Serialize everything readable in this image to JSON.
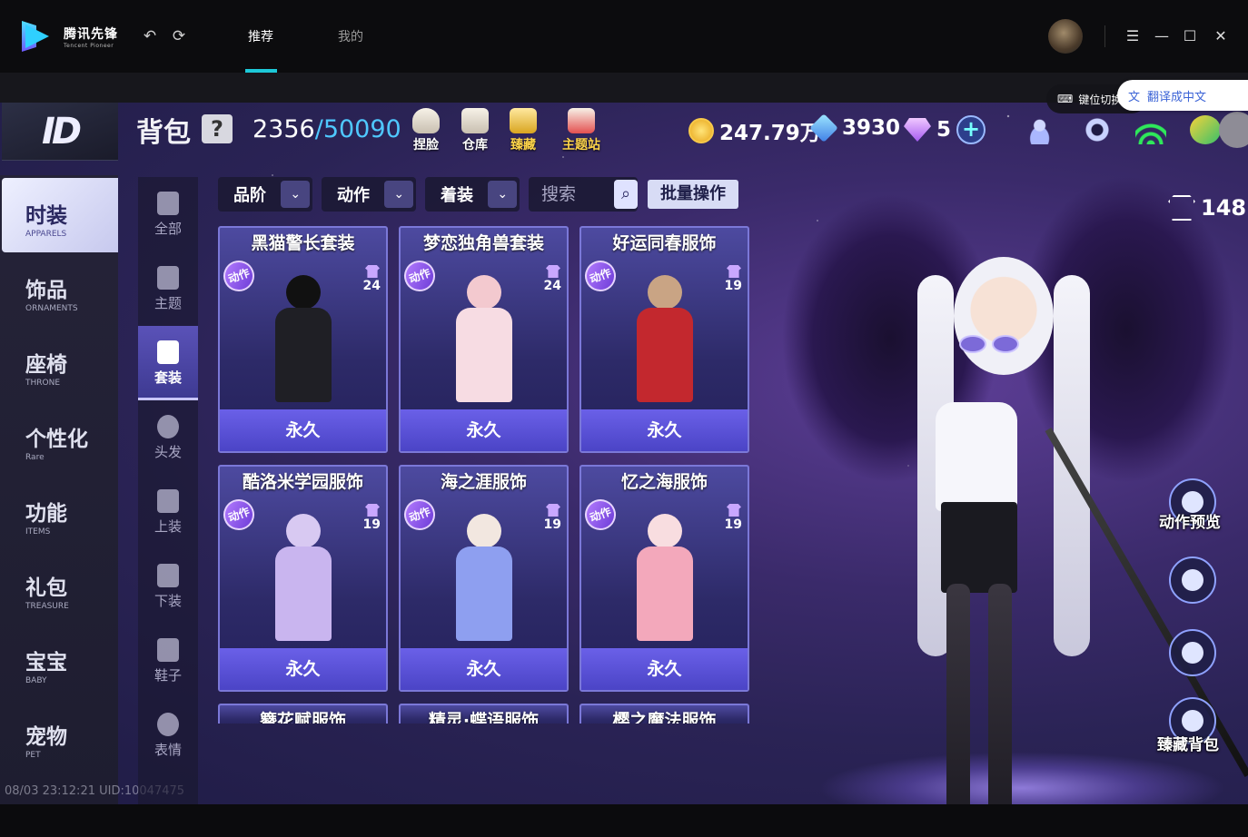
{
  "launcher": {
    "logo_cn": "腾讯先锋",
    "logo_en": "Tencent Pioneer",
    "tabs": [
      "推荐",
      "我的"
    ],
    "active_tab": "推荐",
    "accent_color": "#1dc9d8"
  },
  "overlay": {
    "keymap_label": "键位切换",
    "translate_label": "翻译成中文"
  },
  "hud": {
    "title": "背包",
    "help_label": "?",
    "capacity_used": "2356",
    "capacity_max": "/50090",
    "shortcuts": [
      {
        "label": "捏脸",
        "icon": "bulb-icon"
      },
      {
        "label": "仓库",
        "icon": "warehouse-icon"
      },
      {
        "label": "臻藏",
        "icon": "treasure-icon"
      },
      {
        "label": "主题站",
        "icon": "theme-station-icon"
      }
    ],
    "gold": "247.79万",
    "blue_gem": "3930",
    "diamond": "5",
    "plus_label": "+"
  },
  "categories": [
    {
      "cn": "时装",
      "en": "APPARELS",
      "active": true
    },
    {
      "cn": "饰品",
      "en": "ORNAMENTS"
    },
    {
      "cn": "座椅",
      "en": "THRONE"
    },
    {
      "cn": "个性化",
      "en": "Rare"
    },
    {
      "cn": "功能",
      "en": "ITEMS"
    },
    {
      "cn": "礼包",
      "en": "TREASURE"
    },
    {
      "cn": "宝宝",
      "en": "BABY"
    },
    {
      "cn": "宠物",
      "en": "PET"
    }
  ],
  "subcategories": [
    {
      "label": "全部",
      "icon": "grid-icon"
    },
    {
      "label": "主题",
      "icon": "wand-icon"
    },
    {
      "label": "套装",
      "icon": "outfit-icon",
      "active": true
    },
    {
      "label": "头发",
      "icon": "hair-icon"
    },
    {
      "label": "上装",
      "icon": "top-icon"
    },
    {
      "label": "下装",
      "icon": "pants-icon"
    },
    {
      "label": "鞋子",
      "icon": "shoe-icon"
    },
    {
      "label": "表情",
      "icon": "face-icon"
    }
  ],
  "filters": {
    "dropdowns": [
      "品阶",
      "动作",
      "着装"
    ],
    "search_placeholder": "搜索",
    "batch_label": "批量操作"
  },
  "items": [
    {
      "name": "黑猫警长套装",
      "badge": "动作",
      "count": "24",
      "status": "永久",
      "head": "#111",
      "body": "#1f1f25"
    },
    {
      "name": "梦恋独角兽套装",
      "badge": "动作",
      "count": "24",
      "status": "永久",
      "head": "#f3c9cf",
      "body": "#f7dce3"
    },
    {
      "name": "好运同春服饰",
      "badge": "动作",
      "count": "19",
      "status": "永久",
      "head": "#c9a484",
      "body": "#c3282e"
    },
    {
      "name": "酷洛米学园服饰",
      "badge": "动作",
      "count": "19",
      "status": "永久",
      "head": "#d8c9f2",
      "body": "#c9b5ef"
    },
    {
      "name": "海之涯服饰",
      "badge": "动作",
      "count": "19",
      "status": "永久",
      "head": "#f2e7e0",
      "body": "#8e9ff0"
    },
    {
      "name": "忆之海服饰",
      "badge": "动作",
      "count": "19",
      "status": "永久",
      "head": "#f8dde0",
      "body": "#f3a8bb"
    },
    {
      "name": "簪花赋服饰"
    },
    {
      "name": "精灵·蝶语服饰"
    },
    {
      "name": "樱之魔法服饰"
    }
  ],
  "display": {
    "outfit_count": "148",
    "actions": [
      {
        "label": "动作预览",
        "icon": "play-icon"
      },
      {
        "label": "",
        "icon": "gender-switch-icon"
      },
      {
        "label": "",
        "icon": "outfit-slot-icon"
      },
      {
        "label": "臻藏背包",
        "icon": "treasure-bag-icon"
      }
    ]
  },
  "footer": {
    "info": "08/03 23:12:21 UID:10047475"
  }
}
